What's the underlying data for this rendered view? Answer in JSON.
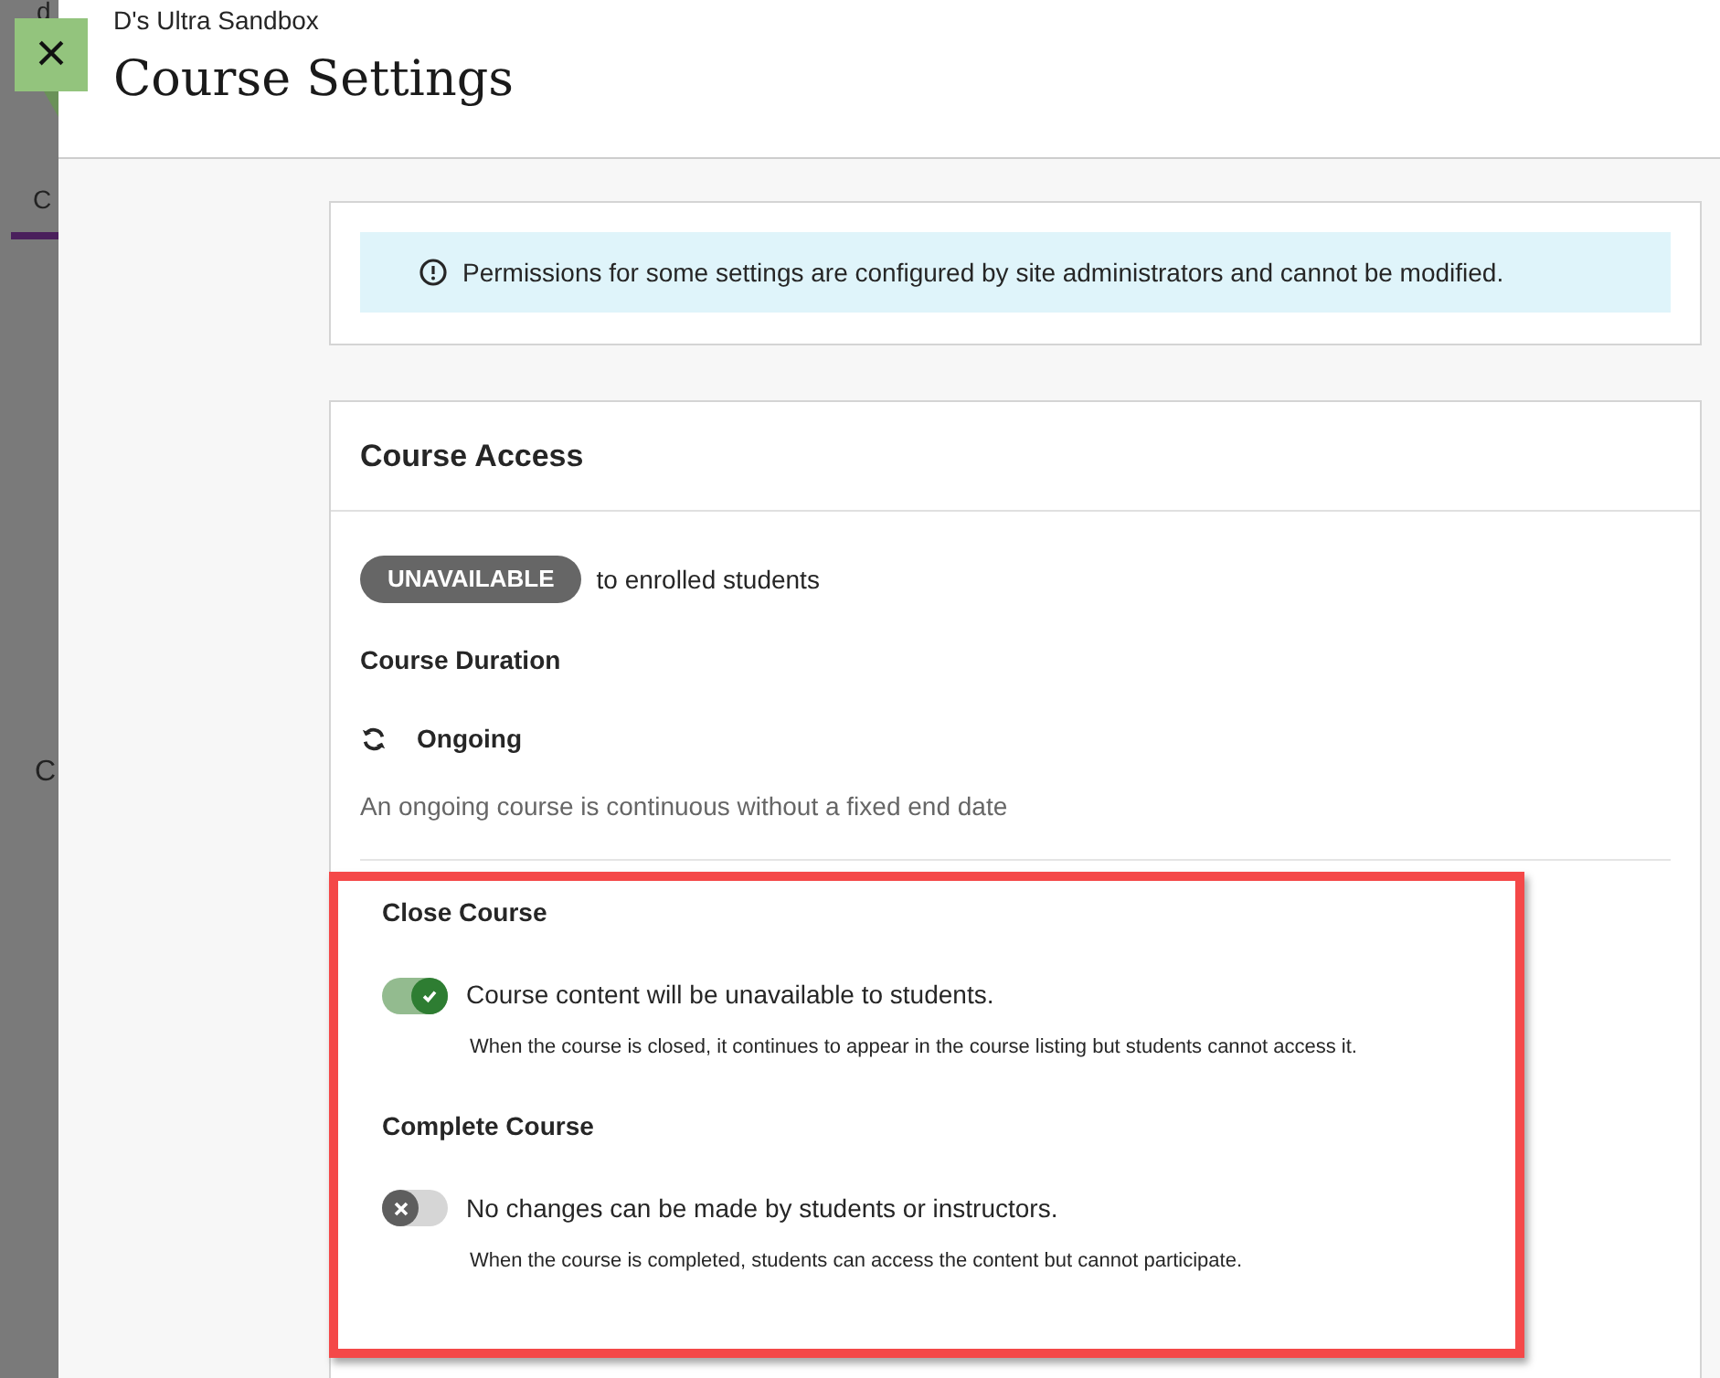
{
  "background": {
    "fragments": [
      "d",
      "C",
      "C"
    ]
  },
  "header": {
    "course_name": "D's Ultra Sandbox",
    "title": "Course Settings",
    "close_symbol": "×"
  },
  "notice": {
    "text": "Permissions for some settings are configured by site administrators and cannot be modified."
  },
  "course_access": {
    "title": "Course Access",
    "availability_badge": "UNAVAILABLE",
    "availability_text": "to enrolled students",
    "duration_label": "Course Duration",
    "duration_value": "Ongoing",
    "duration_description": "An ongoing course is continuous without a fixed end date",
    "toggles": [
      {
        "label": "Close Course",
        "text": "Course content will be unavailable to students.",
        "help": "When the course is closed, it continues to appear in the course listing but students cannot access it.",
        "on": true
      },
      {
        "label": "Complete Course",
        "text": "No changes can be made by students or instructors.",
        "help": "When the course is completed, students can access the content but cannot participate.",
        "on": false
      }
    ]
  }
}
